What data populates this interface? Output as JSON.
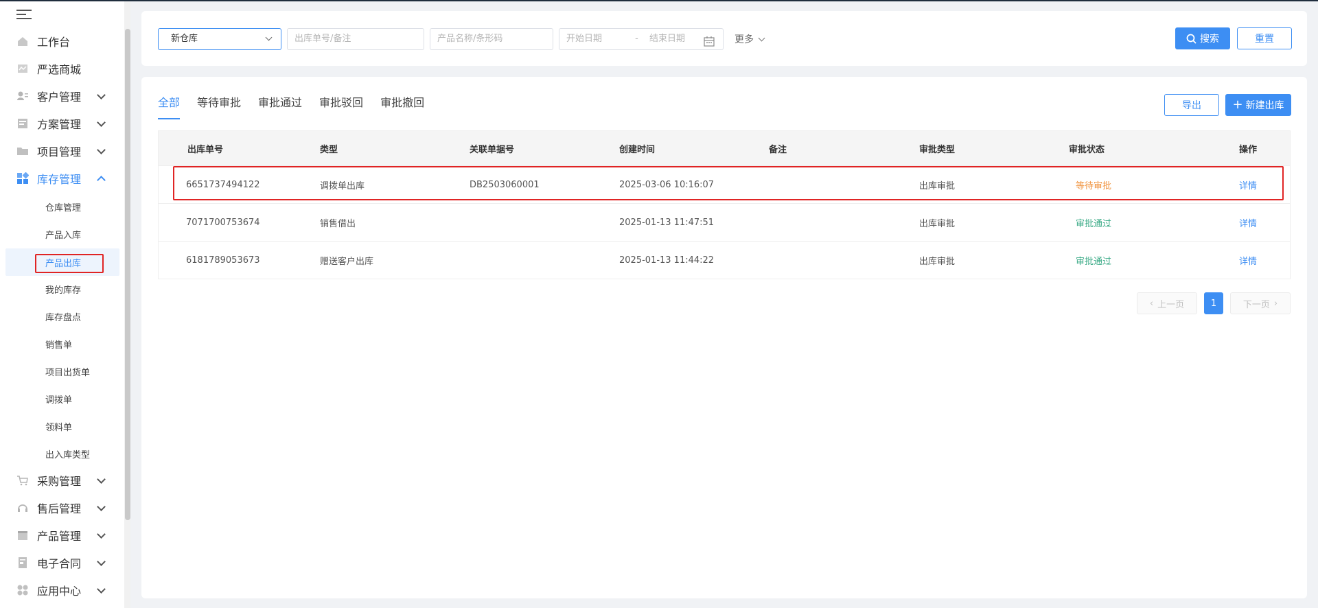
{
  "sidebar": {
    "items": [
      {
        "label": "工作台",
        "icon": "home-icon",
        "expandable": false
      },
      {
        "label": "严选商城",
        "icon": "mall-icon",
        "expandable": false
      },
      {
        "label": "客户管理",
        "icon": "customer-icon",
        "expandable": true
      },
      {
        "label": "方案管理",
        "icon": "plan-icon",
        "expandable": true
      },
      {
        "label": "项目管理",
        "icon": "folder-icon",
        "expandable": true
      },
      {
        "label": "库存管理",
        "icon": "inventory-icon",
        "expandable": true,
        "expanded": true
      },
      {
        "label": "采购管理",
        "icon": "cart-icon",
        "expandable": true
      },
      {
        "label": "售后管理",
        "icon": "headset-icon",
        "expandable": true
      },
      {
        "label": "产品管理",
        "icon": "box-icon",
        "expandable": true
      },
      {
        "label": "电子合同",
        "icon": "contract-icon",
        "expandable": true
      },
      {
        "label": "应用中心",
        "icon": "apps-icon",
        "expandable": true
      }
    ],
    "sub_items": [
      "仓库管理",
      "产品入库",
      "产品出库",
      "我的库存",
      "库存盘点",
      "销售单",
      "项目出货单",
      "调拨单",
      "领料单",
      "出入库类型"
    ],
    "active_sub": "产品出库"
  },
  "filters": {
    "warehouse": "新仓库",
    "order_placeholder": "出库单号/备注",
    "product_placeholder": "产品名称/条形码",
    "start_date_placeholder": "开始日期",
    "date_sep": "-",
    "end_date_placeholder": "结束日期",
    "more": "更多",
    "search": "搜索",
    "reset": "重置"
  },
  "tabs": [
    "全部",
    "等待审批",
    "审批通过",
    "审批驳回",
    "审批撤回"
  ],
  "actions": {
    "export": "导出",
    "new": "新建出库"
  },
  "table": {
    "headers": [
      "出库单号",
      "类型",
      "关联单据号",
      "创建时间",
      "备注",
      "审批类型",
      "审批状态",
      "操作"
    ],
    "rows": [
      {
        "id": "6651737494122",
        "type": "调拨单出库",
        "ref": "DB2503060001",
        "created": "2025-03-06 10:16:07",
        "note": "",
        "approval_type": "出库审批",
        "status": "等待审批",
        "status_kind": "pending",
        "action": "详情"
      },
      {
        "id": "7071700753674",
        "type": "销售借出",
        "ref": "",
        "created": "2025-01-13 11:47:51",
        "note": "",
        "approval_type": "出库审批",
        "status": "审批通过",
        "status_kind": "pass",
        "action": "详情"
      },
      {
        "id": "6181789053673",
        "type": "赠送客户出库",
        "ref": "",
        "created": "2025-01-13 11:44:22",
        "note": "",
        "approval_type": "出库审批",
        "status": "审批通过",
        "status_kind": "pass",
        "action": "详情"
      }
    ]
  },
  "pager": {
    "prev": "上一页",
    "current": "1",
    "next": "下一页"
  },
  "colors": {
    "accent": "#3d8ef3",
    "pending": "#f0913a",
    "pass": "#3aaa86",
    "highlight": "#e02424"
  }
}
